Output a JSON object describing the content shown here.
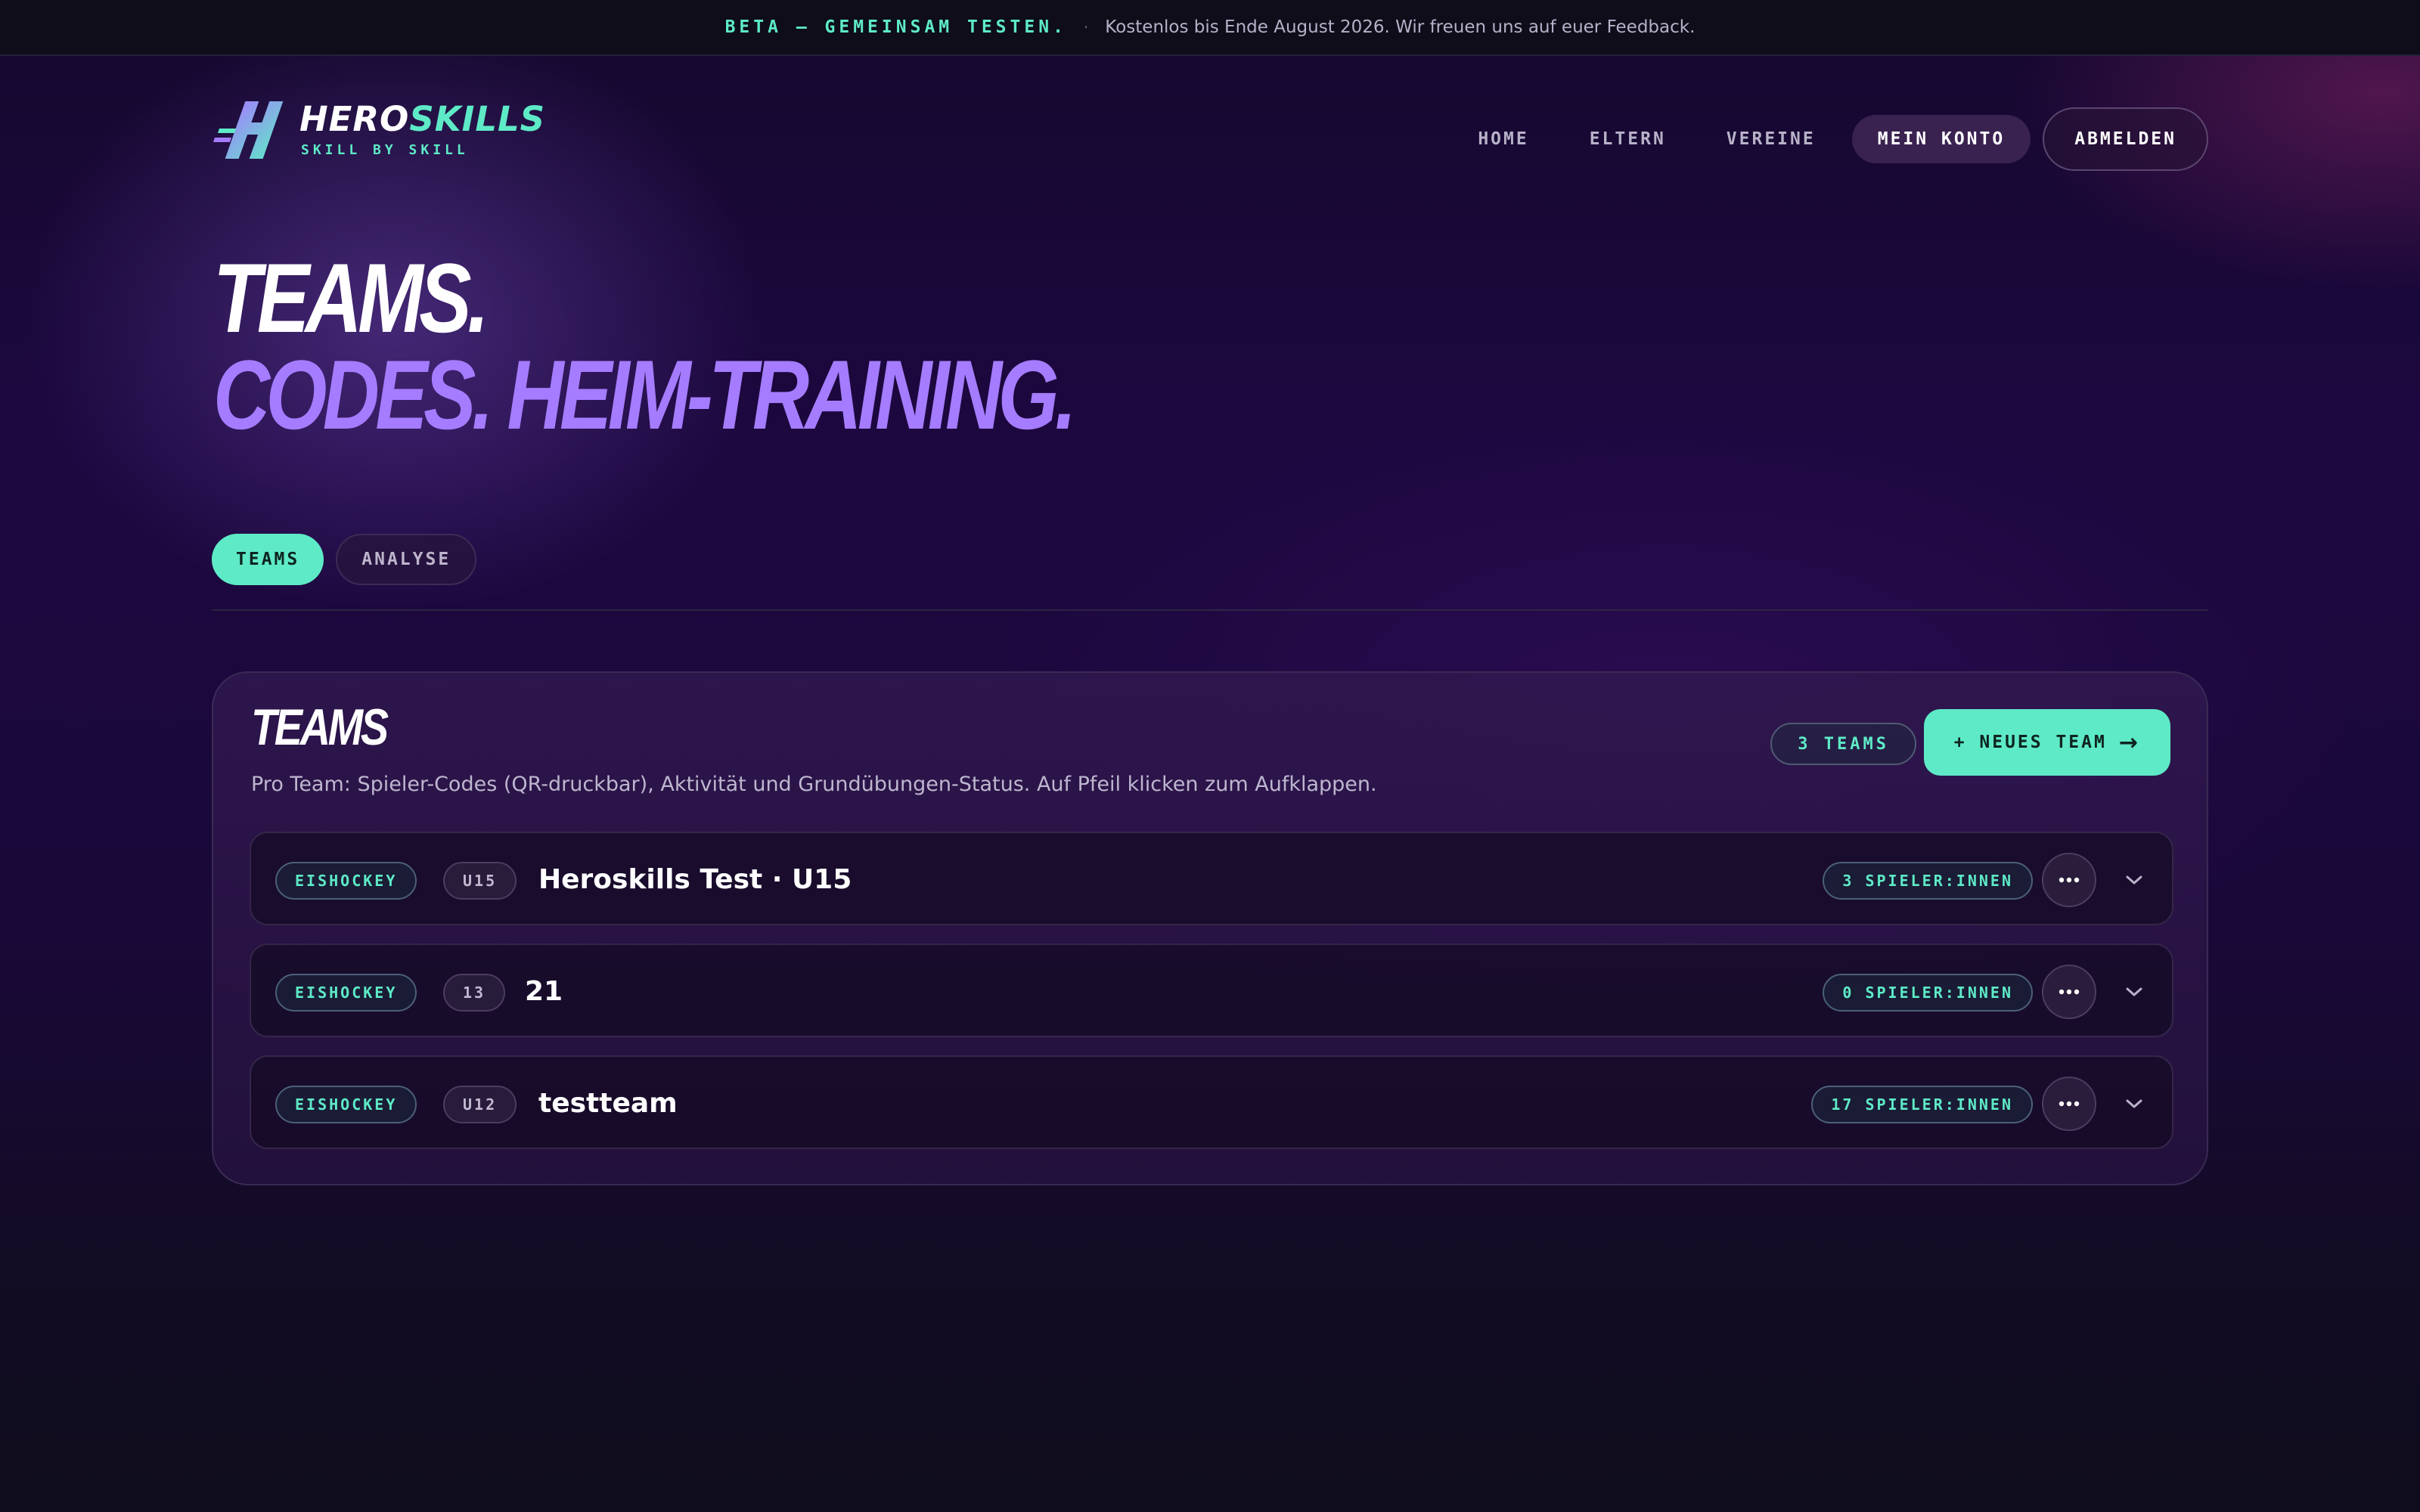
{
  "beta_bar": {
    "headline": "BETA — GEMEINSAM TESTEN.",
    "separator": "·",
    "text": "Kostenlos bis Ende August 2026. Wir freuen uns auf euer Feedback."
  },
  "brand": {
    "name_part1": "HERO",
    "name_part2": "SKILLS",
    "tagline": "SKILL BY SKILL",
    "accent_color": "#5eeac7",
    "purple_color": "#a57cff"
  },
  "nav": {
    "home": "HOME",
    "eltern": "ELTERN",
    "vereine": "VEREINE",
    "mein_konto": "MEIN KONTO",
    "abmelden": "ABMELDEN"
  },
  "hero": {
    "line1": "TEAMS.",
    "line2": "CODES. HEIM-TRAINING."
  },
  "tabs": [
    {
      "label": "TEAMS",
      "active": true
    },
    {
      "label": "ANALYSE",
      "active": false
    }
  ],
  "teams_card": {
    "title": "TEAMS",
    "description": "Pro Team: Spieler-Codes (QR-druckbar), Aktivität und Grundübungen-Status. Auf Pfeil klicken zum Aufklappen.",
    "count_label": "3 TEAMS",
    "new_team_label": "+ NEUES TEAM",
    "new_team_arrow": "→",
    "teams": [
      {
        "sport": "EISHOCKEY",
        "age": "U15",
        "name": "Heroskills Test · U15",
        "players": "3 SPIELER:INNEN"
      },
      {
        "sport": "EISHOCKEY",
        "age": "13",
        "name": "21",
        "players": "0 SPIELER:INNEN"
      },
      {
        "sport": "EISHOCKEY",
        "age": "U12",
        "name": "testteam",
        "players": "17 SPIELER:INNEN"
      }
    ]
  },
  "icons": {
    "logo": "hero-h-logo-icon",
    "more": "more-dots-icon",
    "expand": "chevron-down-icon"
  }
}
